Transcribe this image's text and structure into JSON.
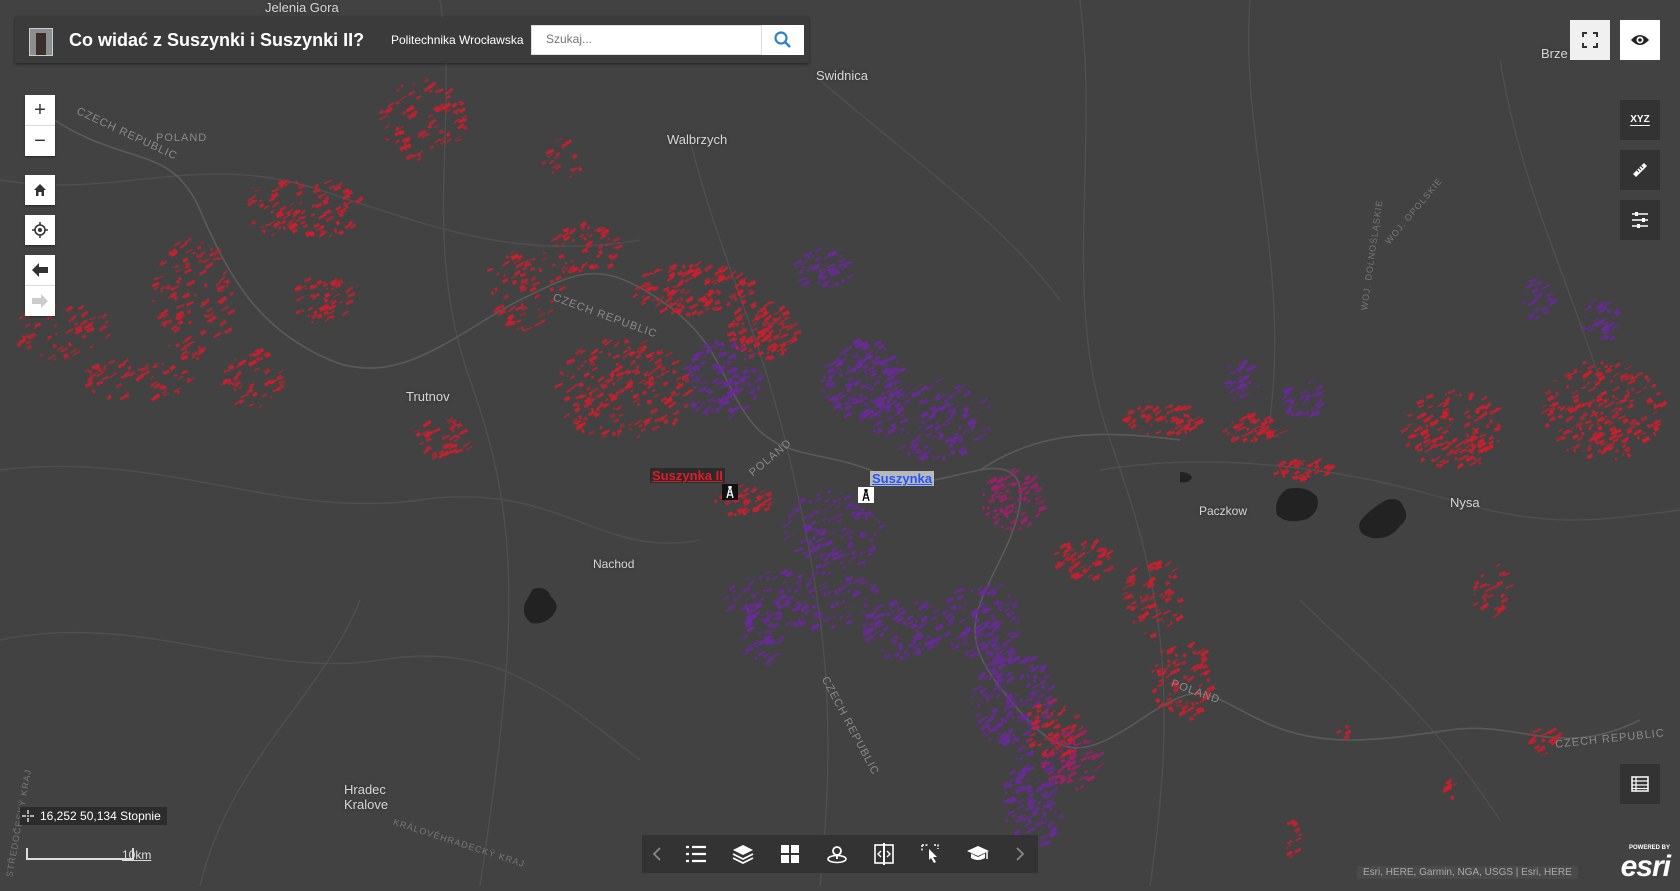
{
  "app": {
    "title": "Co widać z Suszynki i Suszynki II?",
    "subtitle": "Politechnika Wrocławska",
    "search": {
      "placeholder": "Szukaj..."
    }
  },
  "map": {
    "cities": [
      "Jelenia Gora",
      "Swidnica",
      "Walbrzych",
      "Trutnov",
      "Nachod",
      "Paczkow",
      "Nysa",
      "Hradec Kralove",
      "Brze"
    ],
    "country_labels": {
      "czech_republic": "CZECH REPUBLIC",
      "poland": "POLAND"
    },
    "region_labels": {
      "woj_dolnoslaskie": "WOJ. DOLNOŚLĄSKIE",
      "woj_opolskie": "WOJ. OPOLSKIE",
      "kralovehradecky": "KRÁLOVÉHRADECKÝ KRAJ",
      "stredocesky": "STŘEDOČESKÝ KRAJ"
    },
    "observation_sites": [
      {
        "name": "Suszynka II",
        "color": "#e01c2a"
      },
      {
        "name": "Suszynka",
        "color": "#2255ff"
      }
    ],
    "viewshed_colors": {
      "suszynka_ii": "#c8202e",
      "suszynka": "#6a2a9a",
      "overlap": "#a0206a"
    },
    "background_color": "#424242"
  },
  "controls": {
    "zoom_in": "+",
    "zoom_out": "−",
    "home": "home-icon",
    "locate": "locate-icon",
    "back": "arrow-left-icon",
    "forward": "arrow-right-icon"
  },
  "coordinates": {
    "text": "16,252 50,134 Stopnie"
  },
  "scale": {
    "label": "10km"
  },
  "attribution": "Esri, HERE, Garmin, NGA, USGS | Esri, HERE",
  "esri": {
    "powered": "POWERED BY",
    "word": "esri"
  },
  "right_tools": [
    "fullscreen-icon",
    "eye-icon",
    "xyz-icon",
    "ruler-icon",
    "filter-icon",
    "attribute-table-icon"
  ],
  "xyz_label": "XYZ",
  "bottom_toolbar": [
    "previous-icon",
    "legend-icon",
    "layers-icon",
    "basemap-gallery-icon",
    "directions-icon",
    "swipe-icon",
    "select-icon",
    "education-icon",
    "next-icon"
  ]
}
